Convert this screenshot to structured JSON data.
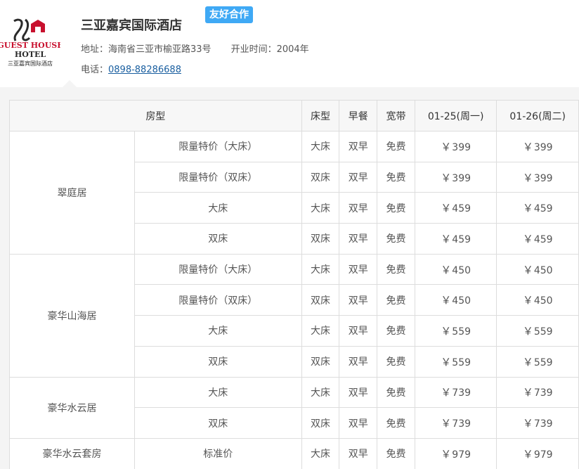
{
  "hotel": {
    "name": "三亚嘉宾国际酒店",
    "badge": "友好合作",
    "address_label": "地址：",
    "address": "海南省三亚市榆亚路33号",
    "opening_label": "开业时间：",
    "opening_year": "2004年",
    "phone_label": "电话：",
    "phone": "0898-88286688",
    "logo_text_top": "GUEST HOUSE",
    "logo_text_mid": "HOTEL",
    "logo_text_cn": "三亚嘉宾国际酒店"
  },
  "colors": {
    "badge_bg": "#3fa9f5",
    "price": "#e63333",
    "link": "#1a5fa0",
    "logo_red": "#c8102e"
  },
  "table": {
    "headers": [
      "房型",
      "床型",
      "早餐",
      "宽带",
      "01-25(周一)",
      "01-26(周二)"
    ],
    "currency": "￥",
    "groups": [
      {
        "name": "翠庭居",
        "rooms": [
          {
            "plan": "限量特价（大床）",
            "bed": "大床",
            "breakfast": "双早",
            "internet": "免费",
            "price1": "399",
            "price2": "399"
          },
          {
            "plan": "限量特价（双床）",
            "bed": "双床",
            "breakfast": "双早",
            "internet": "免费",
            "price1": "399",
            "price2": "399"
          },
          {
            "plan": "大床",
            "bed": "大床",
            "breakfast": "双早",
            "internet": "免费",
            "price1": "459",
            "price2": "459"
          },
          {
            "plan": "双床",
            "bed": "双床",
            "breakfast": "双早",
            "internet": "免费",
            "price1": "459",
            "price2": "459"
          }
        ]
      },
      {
        "name": "豪华山海居",
        "rooms": [
          {
            "plan": "限量特价（大床）",
            "bed": "大床",
            "breakfast": "双早",
            "internet": "免费",
            "price1": "450",
            "price2": "450"
          },
          {
            "plan": "限量特价（双床）",
            "bed": "双床",
            "breakfast": "双早",
            "internet": "免费",
            "price1": "450",
            "price2": "450"
          },
          {
            "plan": "大床",
            "bed": "大床",
            "breakfast": "双早",
            "internet": "免费",
            "price1": "559",
            "price2": "559"
          },
          {
            "plan": "双床",
            "bed": "双床",
            "breakfast": "双早",
            "internet": "免费",
            "price1": "559",
            "price2": "559"
          }
        ]
      },
      {
        "name": "豪华水云居",
        "rooms": [
          {
            "plan": "大床",
            "bed": "大床",
            "breakfast": "双早",
            "internet": "免费",
            "price1": "739",
            "price2": "739"
          },
          {
            "plan": "双床",
            "bed": "双床",
            "breakfast": "双早",
            "internet": "免费",
            "price1": "739",
            "price2": "739"
          }
        ]
      },
      {
        "name": "豪华水云套房",
        "rooms": [
          {
            "plan": "标准价",
            "bed": "大床",
            "breakfast": "双早",
            "internet": "免费",
            "price1": "979",
            "price2": "979"
          }
        ]
      }
    ]
  }
}
